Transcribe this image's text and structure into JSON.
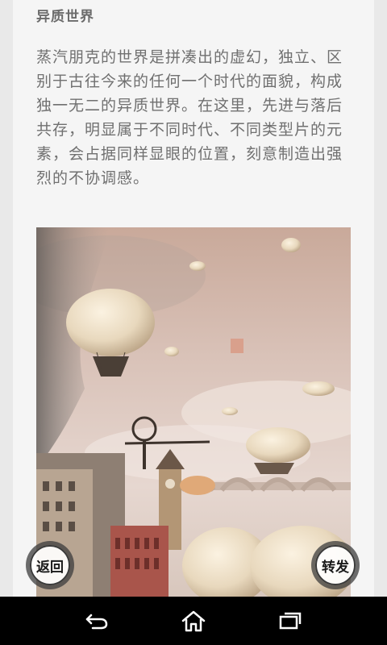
{
  "article": {
    "section_title": "异质世界",
    "paragraph": "蒸汽朋克的世界是拼凑出的虚幻，独立、区别于古往今来的任何一个时代的面貌，构成独一无二的异质世界。在这里，先进与落后共存，明显属于不同时代、不同类型片的元素，会占据同样显眼的位置，刻意制造出强烈的不协调感。"
  },
  "buttons": {
    "back_label": "返回",
    "share_label": "转发"
  },
  "navbar": {
    "back_icon": "back-arrow-icon",
    "home_icon": "home-icon",
    "recents_icon": "recent-apps-icon"
  },
  "colors": {
    "text": "#707070",
    "title": "#6b6b6b",
    "navbar": "#000000"
  }
}
